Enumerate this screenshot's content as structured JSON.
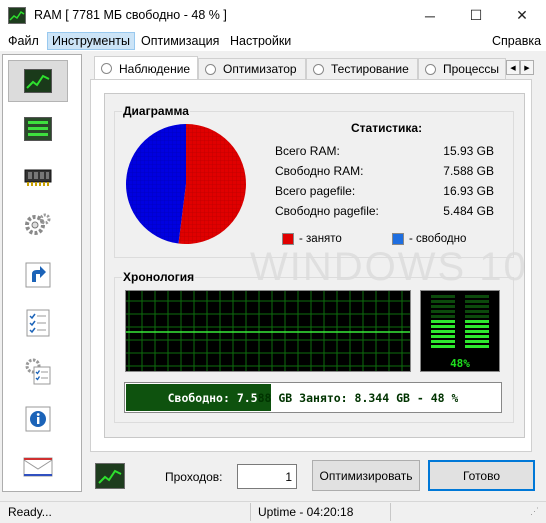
{
  "window": {
    "title": "RAM [ 7781 МБ свободно - 48 % ]",
    "controls": {
      "minimize": "─",
      "maximize": "☐",
      "close": "✕"
    }
  },
  "menu": {
    "file": "Файл",
    "tools": "Инструменты",
    "optimize": "Оптимизация",
    "settings": "Настройки",
    "help": "Справка"
  },
  "sidebar": {
    "icons": [
      "chart-icon",
      "list-icon",
      "ram-chip-icon",
      "gears-icon",
      "shortcut-arrow-icon",
      "checklist-icon",
      "settings-checklist-icon",
      "info-icon",
      "mail-icon"
    ]
  },
  "tabs": [
    {
      "label": "Наблюдение",
      "active": true
    },
    {
      "label": "Оптимизатор",
      "active": false
    },
    {
      "label": "Тестирование",
      "active": false
    },
    {
      "label": "Процессы",
      "active": false
    }
  ],
  "diagram": {
    "title": "Диаграмма",
    "stats_title": "Статистика:",
    "stats": [
      {
        "label": "Всего RAM:",
        "value": "15.93 GB"
      },
      {
        "label": "Свободно RAM:",
        "value": "7.588 GB"
      },
      {
        "label": "Всего pagefile:",
        "value": "16.93 GB"
      },
      {
        "label": "Свободно pagefile:",
        "value": "5.484 GB"
      }
    ],
    "legend_used": "- занято",
    "legend_free": "- свободно",
    "used_color": "#e00000",
    "free_color": "#0000e0"
  },
  "chart_data": {
    "type": "pie",
    "categories": [
      "занято",
      "свободно"
    ],
    "values": [
      52,
      48
    ]
  },
  "history": {
    "title": "Хронология",
    "gauge_label": "48%",
    "gauge_level": 0.48,
    "memory_bar_text": "Свободно: 7.588 GB  Занято: 8.344 GB - 48 %",
    "memory_bar_level": 0.48
  },
  "watermark": "WINDOWS 10",
  "bottom": {
    "passes_label": "Проходов:",
    "passes_value": "1",
    "optimize_button": "Оптимизировать",
    "done_button": "Готово"
  },
  "status": {
    "left": "Ready...",
    "uptime": "Uptime - 04:20:18"
  }
}
